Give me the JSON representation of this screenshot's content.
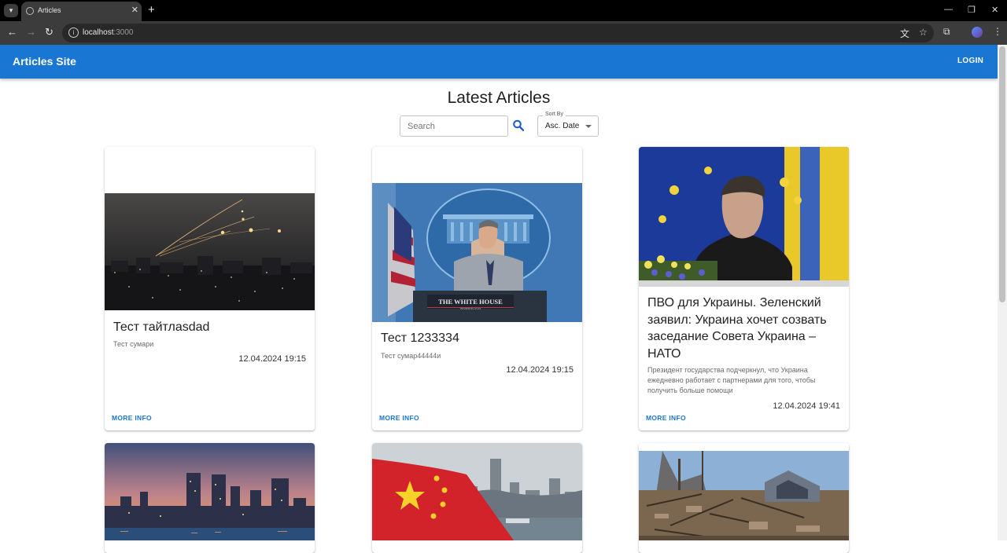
{
  "browser": {
    "tab_title": "Articles",
    "url_host": "localhost",
    "url_port": ":3000"
  },
  "app": {
    "brand": "Articles Site",
    "login_label": "LOGIN",
    "accent": "#1976d2"
  },
  "page": {
    "title": "Latest Articles",
    "search_placeholder": "Search",
    "sort_label": "Sort By",
    "sort_value": "Asc. Date"
  },
  "articles": [
    {
      "title": "Тест тайтлasdad",
      "summary": "Тест сумари",
      "date": "12.04.2024 19:15",
      "more_label": "MORE INFO",
      "image": "night-city-rockets"
    },
    {
      "title": "Тест 1233334",
      "summary": "Тест сумар44444и",
      "date": "12.04.2024 19:15",
      "more_label": "MORE INFO",
      "image": "white-house-briefing"
    },
    {
      "title": "ПВО для Украины. Зеленский заявил: Украина хочет созвать заседание Совета Украина – НАТО",
      "summary": "Президент государства подчеркнул, что Украина ежедневно работает с партнерами для того, чтобы получить больше помощи",
      "date": "12.04.2024 19:41",
      "more_label": "MORE INFO",
      "image": "speaker-with-flags"
    },
    {
      "image": "city-skyline-sunset"
    },
    {
      "image": "chinese-flag-harbor"
    },
    {
      "image": "destroyed-house"
    }
  ]
}
